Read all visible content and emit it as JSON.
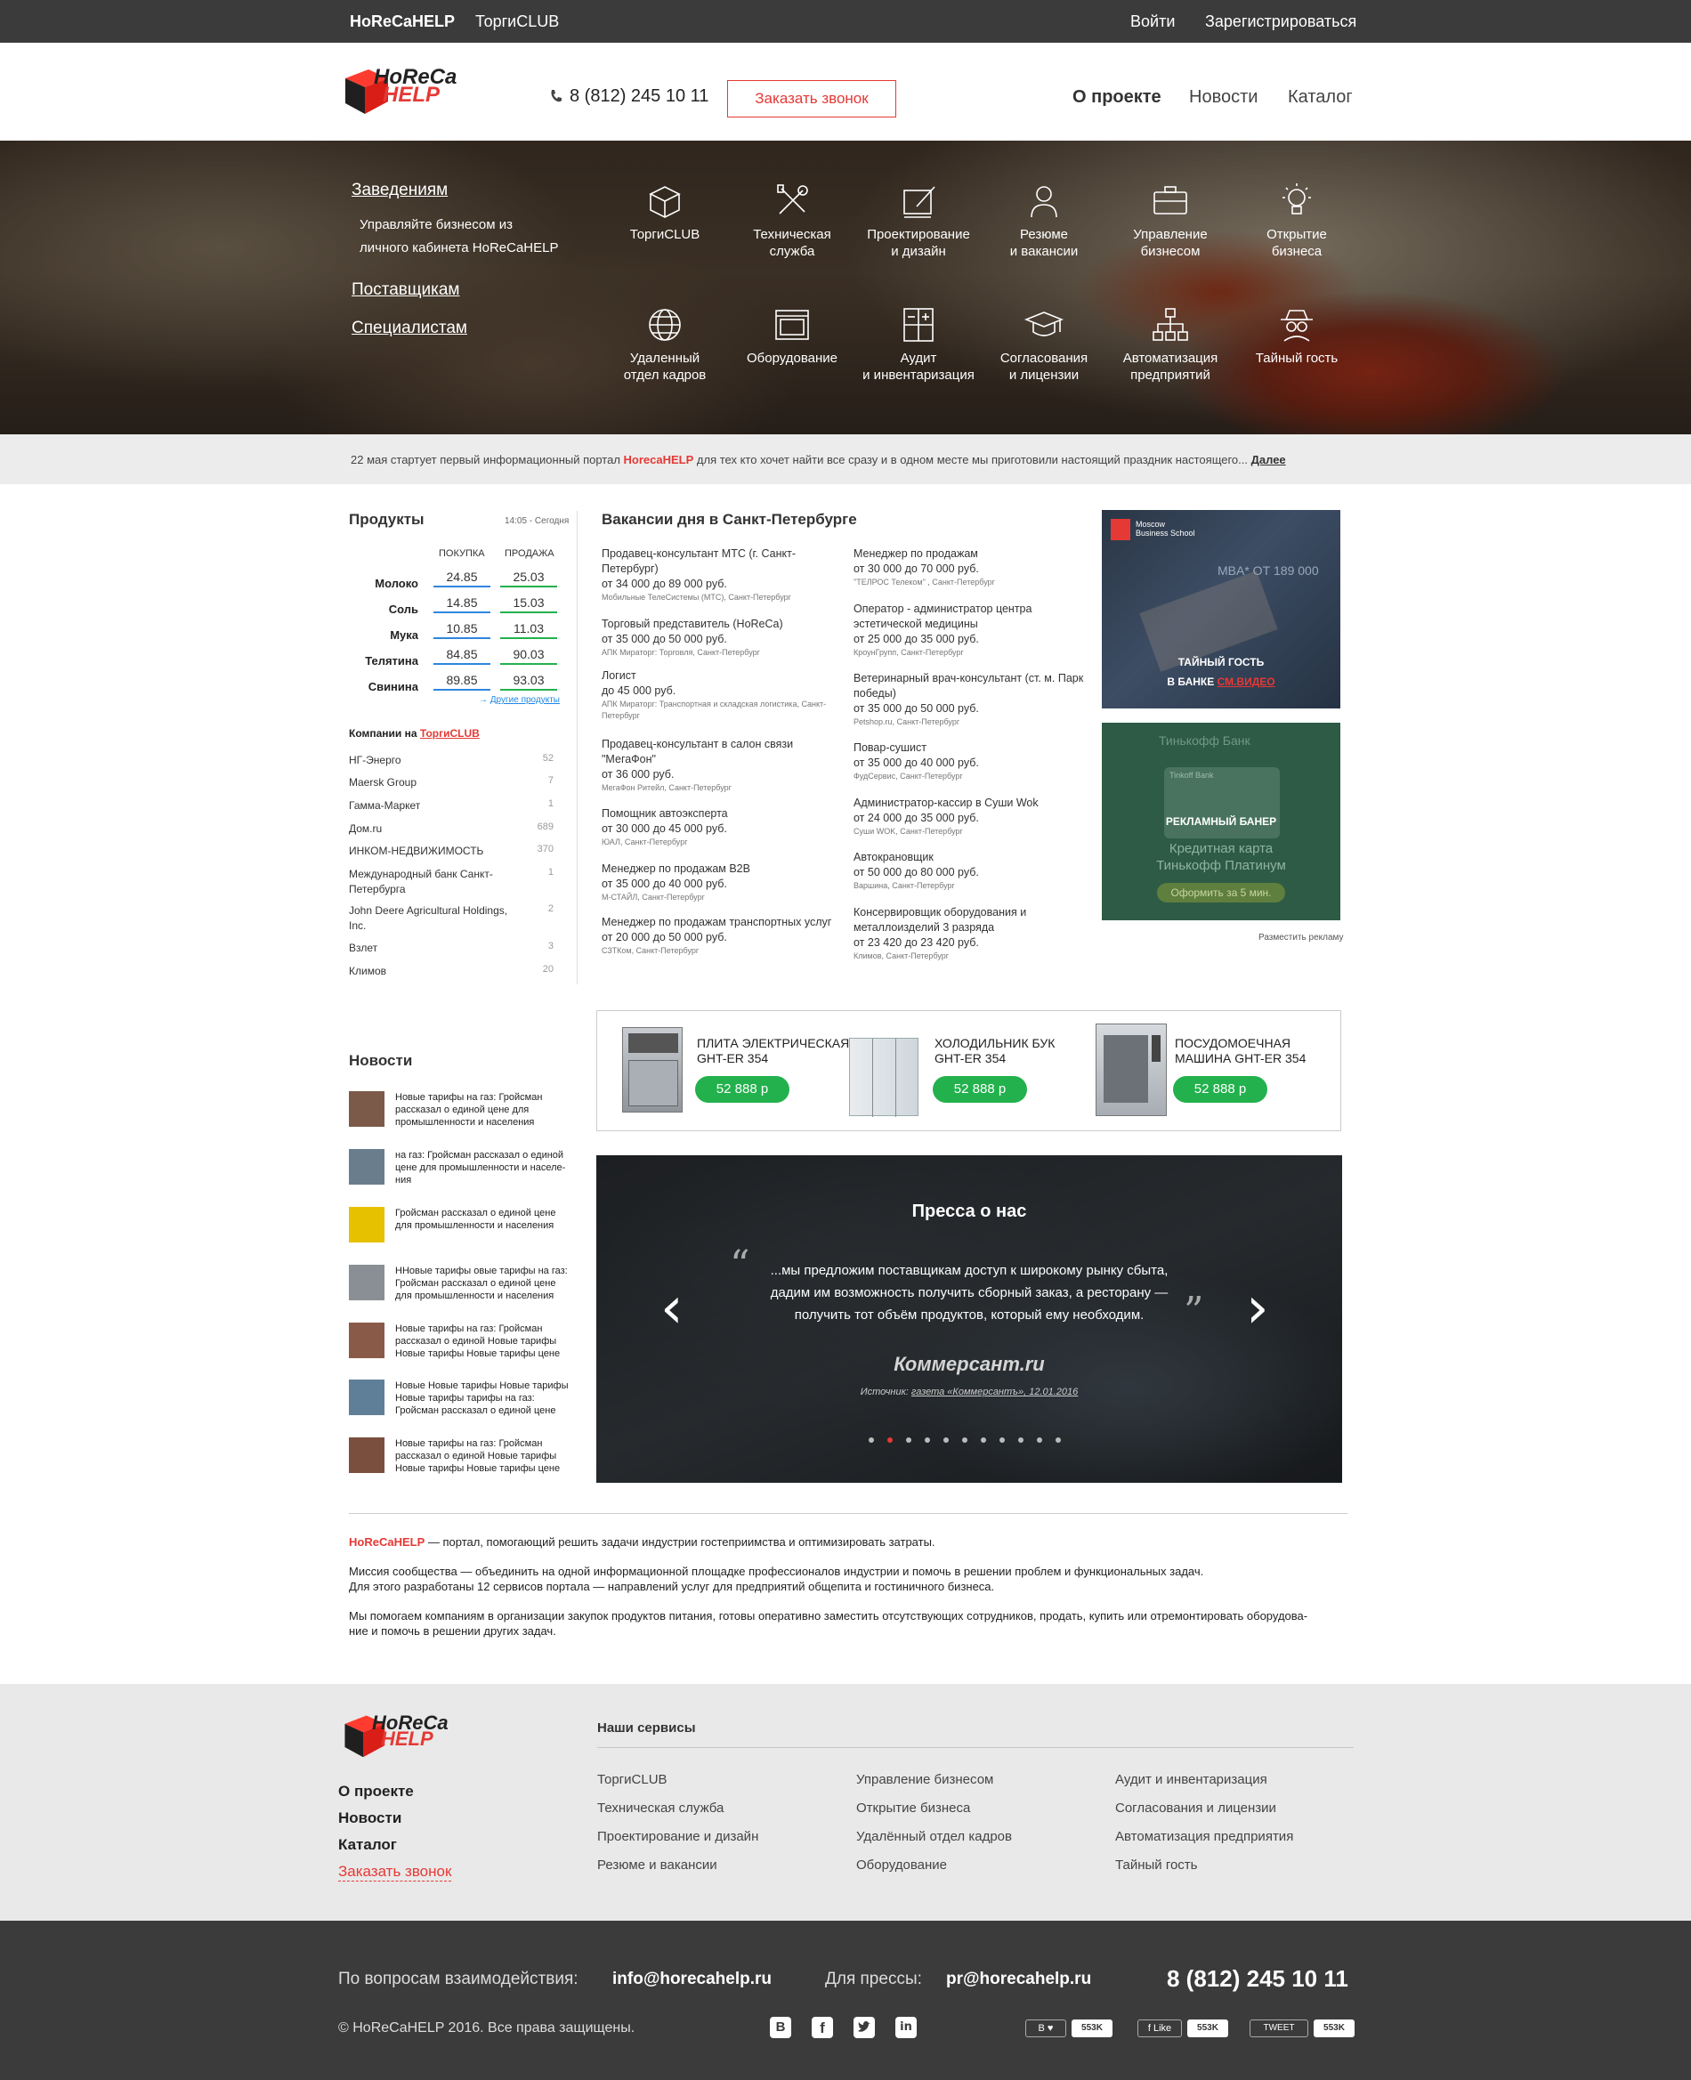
{
  "topbar": {
    "brand": "HoReCaHELP",
    "torgi": "ТоргиCLUB",
    "login": "Войти",
    "register": "Зарегистрироваться"
  },
  "header": {
    "logo_top": "HoReCa",
    "logo_bottom": "HELP",
    "phone": "8 (812) 245 10 11",
    "callback": "Заказать звонок",
    "nav": [
      {
        "label": "О проекте"
      },
      {
        "label": "Новости"
      },
      {
        "label": "Каталог"
      }
    ]
  },
  "hero": {
    "links": {
      "establishments": "Заведениям",
      "establishments_desc_1": "Управляйте бизнесом из",
      "establishments_desc_2": "личного кабинета HoReCaHELP",
      "suppliers": "Поставщикам",
      "specialists": "Специалистам"
    },
    "services": [
      {
        "l1": "ТоргиCLUB",
        "l2": "",
        "icon": "box-icon"
      },
      {
        "l1": "Техническая",
        "l2": "служба",
        "icon": "tools-icon"
      },
      {
        "l1": "Проектирование",
        "l2": "и дизайн",
        "icon": "design-icon"
      },
      {
        "l1": "Резюме",
        "l2": "и вакансии",
        "icon": "person-icon"
      },
      {
        "l1": "Управление бизнесом",
        "l2": "",
        "icon": "briefcase-icon"
      },
      {
        "l1": "Открытие",
        "l2": "бизнеса",
        "icon": "lightbulb-icon"
      },
      {
        "l1": "Удаленный",
        "l2": "отдел кадров",
        "icon": "globe-icon"
      },
      {
        "l1": "Оборудование",
        "l2": "",
        "icon": "oven-icon"
      },
      {
        "l1": "Аудит",
        "l2": "и инвентаризация",
        "icon": "calculator-icon"
      },
      {
        "l1": "Согласования",
        "l2": "и лицензии",
        "icon": "graduation-cap-icon"
      },
      {
        "l1": "Автоматизация",
        "l2": "предприятий",
        "icon": "hierarchy-icon"
      },
      {
        "l1": "Тайный гость",
        "l2": "",
        "icon": "spy-icon"
      }
    ]
  },
  "announce": {
    "pre": "22 мая стартует первый информационный портал ",
    "brand": "HorecaHELP",
    "post": " для тех кто хочет найти все сразу и в одном месте мы приготовили настоящий праздник настоящего... ",
    "more": "Далее"
  },
  "products": {
    "title": "Продукты",
    "time": "14:05 - Сегодня",
    "col_buy": "ПОКУПКА",
    "col_sell": "ПРОДАЖА",
    "rows": [
      {
        "name": "Молоко",
        "buy": "24.85",
        "sell": "25.03"
      },
      {
        "name": "Соль",
        "buy": "14.85",
        "sell": "15.03"
      },
      {
        "name": "Мука",
        "buy": "10.85",
        "sell": "11.03"
      },
      {
        "name": "Телятина",
        "buy": "84.85",
        "sell": "90.03"
      },
      {
        "name": "Свинина",
        "buy": "89.85",
        "sell": "93.03"
      }
    ],
    "more": "Другие продукты",
    "arrow": "→"
  },
  "companies": {
    "title_pre": "Компании на ",
    "title_link": "ТоргиCLUB",
    "items": [
      {
        "name": "НГ-Энерго",
        "n": "52"
      },
      {
        "name": "Maersk Group",
        "n": "7"
      },
      {
        "name": "Гамма-Маркет",
        "n": "1"
      },
      {
        "name": "Дом.ru",
        "n": "689"
      },
      {
        "name": "ИНКОМ-НЕДВИЖИМОСТЬ",
        "n": "370"
      },
      {
        "name": "Международный банк Санкт-Петербурга",
        "n": "1"
      },
      {
        "name": "John Deere Agricultural Holdings, Inc.",
        "n": "2"
      },
      {
        "name": "Взлет",
        "n": "3"
      },
      {
        "name": "Климов",
        "n": "20"
      }
    ]
  },
  "vacancies": {
    "title": "Вакансии дня в Санкт-Петербурге",
    "left": [
      {
        "t": "Продавец-консультант МТС (г. Санкт-Петербург)",
        "s": "от 34 000 до 89 000 руб.",
        "m": "Мобильные ТелеСистемы (МТС), Санкт-Петербург"
      },
      {
        "t": "Торговый представитель (HoReCa)",
        "s": "от 35 000 до 50 000 руб.",
        "m": "АПК Мираторг: Торговля, Санкт-Петербург"
      },
      {
        "t": "Логист",
        "s": "до 45 000 руб.",
        "m": "АПК Мираторг: Транспортная и складская логистика, Санкт-Петербург"
      },
      {
        "t": "Продавец-консультант в салон связи \"МегаФон\"",
        "s": "от 36 000 руб.",
        "m": "МегаФон Ритейл, Санкт-Петербург"
      },
      {
        "t": "Помощник автоэксперта",
        "s": "от 30 000 до 45 000 руб.",
        "m": "ЮАЛ, Санкт-Петербург"
      },
      {
        "t": "Менеджер по продажам B2B",
        "s": "от 35 000 до 40 000 руб.",
        "m": "М-СТАЙЛ, Санкт-Петербург"
      },
      {
        "t": "Менеджер по продажам транспортных услуг",
        "s": "от 20 000 до 50 000 руб.",
        "m": "СЗТКом, Санкт-Петербург"
      }
    ],
    "right": [
      {
        "t": "Менеджер по продажам",
        "s": "от 30 000 до 70 000 руб.",
        "m": "\"ТЕЛРОС Телеком\" , Санкт-Петербург"
      },
      {
        "t": "Оператор - администратор центра эстетической медицины",
        "s": "от 25 000 до 35 000 руб.",
        "m": "КроунГрупп, Санкт-Петербург"
      },
      {
        "t": "Ветеринарный врач-консультант (ст. м. Парк победы)",
        "s": "от 35 000 до 50 000 руб.",
        "m": "Petshop.ru, Санкт-Петербург"
      },
      {
        "t": "Повар-сушист",
        "s": "от 35 000 до 40 000 руб.",
        "m": "ФудСервис, Санкт-Петербург"
      },
      {
        "t": "Администратор-кассир в Суши Wok",
        "s": "от 24 000 до 35 000 руб.",
        "m": "Суши WOK, Санкт-Петербург"
      },
      {
        "t": "Автокрановщик",
        "s": "от 50 000 до 80 000 руб.",
        "m": "Варшина, Санкт-Петербург"
      },
      {
        "t": "Консервировщик оборудования и металлоизделий 3 разряда",
        "s": "от 23 420 до 23 420 руб.",
        "m": "Климов, Санкт-Петербург"
      }
    ]
  },
  "ads": {
    "mbs_name_1": "Moscow",
    "mbs_name_2": "Business School",
    "mbs_price": "MBA* ОТ 189 000",
    "mbs_caption_1": "ТАЙНЫЙ ГОСТЬ",
    "mbs_caption_2": "В БАНКЕ ",
    "mbs_caption_link": "СМ.ВИДЕО",
    "tinkoff_name": "Тинькофф Банк",
    "tinkoff_card": "Tinkoff Bank",
    "tinkoff_caption": "РЕКЛАМНЫЙ БАНЕР",
    "tinkoff_line1": "Кредитная карта",
    "tinkoff_line2": "Тинькофф Платинум",
    "tinkoff_btn": "Оформить за 5 мин.",
    "place_ad": "Разместить рекламу"
  },
  "catalog": [
    {
      "l1": "ПЛИТА ЭЛЕКТРИЧЕСКАЯ",
      "l2": "GHT-ER 354",
      "price": "52 888 р"
    },
    {
      "l1": "ХОЛОДИЛЬНИК БУК",
      "l2": "GHT-ER 354",
      "price": "52 888 р"
    },
    {
      "l1": "ПОСУДОМОЕЧНАЯ",
      "l2": "МАШИНА GHT-ER 354",
      "price": "52 888 р"
    }
  ],
  "news": {
    "title": "Новости",
    "items": [
      {
        "t": "Новые тарифы на газ: Гройсман рассказал о единой цене для промышленности и населения"
      },
      {
        "t": "на газ: Гройсман рассказал о единой цене для промышленности и населе-ния"
      },
      {
        "t": "Гройсман рассказал о единой цене для промышленности и населения"
      },
      {
        "t": "ННовые тарифы овые тарифы на газ: Гройсман рассказал о единой цене для промышленности и населения"
      },
      {
        "t": "Новые тарифы на газ: Гройсман рассказал о единой Новые тарифы Новые тарифы Новые тарифы цене"
      },
      {
        "t": "Новые Новые тарифы Новые тарифы Новые тарифы тарифы на газ: Гройсман рассказал о единой цене"
      },
      {
        "t": "Новые тарифы на газ: Гройсман рассказал о единой Новые тарифы Новые тарифы Новые тарифы цене"
      }
    ]
  },
  "press": {
    "title": "Пресса о нас",
    "q1": "...мы предложим поставщикам доступ к широкому рынку сбыта,",
    "q2": "дадим им возможность получить сборный заказ, а ресторану —",
    "q3": "получить тот объём продуктов, который ему необходим.",
    "source_logo": "Коммерсант.ru",
    "source_pre": "Источник: ",
    "source_link": "газета «Коммерсантъ», 12.01.2016",
    "open_quote": "“",
    "close_quote": "”",
    "prev": "‹",
    "next": "›"
  },
  "about": {
    "brand": "HoReCaHELP",
    "p1": " — портал, помогающий решить задачи индустрии гостеприимства и оптимизировать затраты.",
    "p2a": "Миссия сообщества — объединить на одной информационной площадке профессионалов индустрии и помочь в решении проблем и функциональных задач.",
    "p2b": "Для этого разработаны 12 сервисов портала — направлений услуг для предприятий общепита и гостиничного бизнеса.",
    "p3a": "Мы помогаем компаниям в организации закупок продуктов питания, готовы оперативно заместить отсутствующих сотрудников, продать, купить или отремонтировать оборудова-",
    "p3b": "ние и помочь в решении других задач."
  },
  "footer": {
    "nav": [
      {
        "label": "О проекте"
      },
      {
        "label": "Новости"
      },
      {
        "label": "Каталог"
      }
    ],
    "callback": "Заказать звонок",
    "services_title": "Наши сервисы",
    "col1": [
      "ТоргиCLUB",
      "Техническая служба",
      "Проектирование и дизайн",
      "Резюме и вакансии"
    ],
    "col2": [
      "Управление бизнесом",
      "Открытие бизнеса",
      "Удалённый отдел кадров",
      "Оборудование"
    ],
    "col3": [
      "Аудит и инвентаризация",
      "Согласования и лицензии",
      "Автоматизация предприятия",
      "Тайный гость"
    ]
  },
  "bottom": {
    "q_label": "По вопросам взаимодействия:",
    "q_email": "info@horecahelp.ru",
    "press_label": "Для прессы:",
    "press_email": "pr@horecahelp.ru",
    "phone": "8 (812) 245 10 11",
    "copyright": "© HoReCaHELP 2016. Все права защищены.",
    "vk": "В",
    "like": "Like",
    "tweet": "TWEET",
    "count": "553K"
  },
  "colors": {
    "accent": "#e53935",
    "green": "#23b14d",
    "blue": "#2e86de",
    "dark": "#3b3b3b"
  }
}
